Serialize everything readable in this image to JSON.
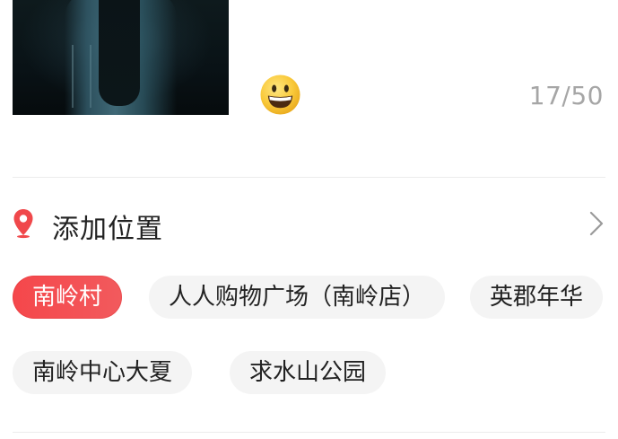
{
  "editor": {
    "photo_alt": "uploaded photo",
    "emoji_icon": "grinning-face-emoji",
    "char_counter": "17/50"
  },
  "location": {
    "label": "添加位置",
    "pin_icon": "location-pin-icon",
    "chevron_icon": "chevron-right-icon",
    "accent_color": "#f0484b"
  },
  "suggestions": [
    {
      "label": "南岭村",
      "selected": true
    },
    {
      "label": "人人购物广场（南岭店）",
      "selected": false
    },
    {
      "label": "英郡年华",
      "selected": false
    },
    {
      "label": "南岭中心大夏",
      "selected": false
    },
    {
      "label": "求水山公园",
      "selected": false
    }
  ]
}
